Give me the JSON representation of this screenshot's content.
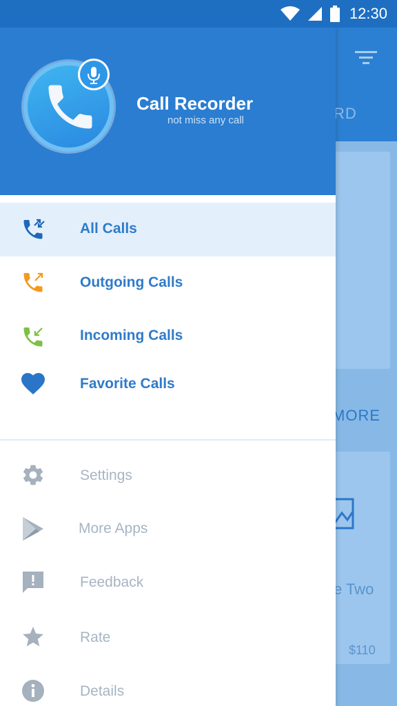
{
  "status_bar": {
    "time": "12:30"
  },
  "background_app": {
    "tab_fragment": "RD",
    "section_fragment": "MORE",
    "card_title_fragment": "e Two",
    "card_price": "$110"
  },
  "drawer": {
    "app_name": "Call Recorder",
    "tagline": "not miss any call",
    "primary_items": [
      {
        "label": "All Calls",
        "icon": "all-calls-icon",
        "active": true
      },
      {
        "label": "Outgoing Calls",
        "icon": "outgoing-call-icon"
      },
      {
        "label": "Incoming Calls",
        "icon": "incoming-call-icon"
      },
      {
        "label": "Favorite Calls",
        "icon": "heart-icon"
      }
    ],
    "secondary_items": [
      {
        "label": "Settings",
        "icon": "gear-icon"
      },
      {
        "label": "More Apps",
        "icon": "play-store-icon"
      },
      {
        "label": "Feedback",
        "icon": "feedback-icon"
      },
      {
        "label": "Rate",
        "icon": "star-icon"
      },
      {
        "label": "Details",
        "icon": "info-icon"
      }
    ]
  },
  "colors": {
    "header_blue": "#2a7dd1",
    "status_bar_blue": "#1e6fc2",
    "primary_text": "#2f7bc9",
    "secondary_text": "#a7b4c3",
    "active_bg": "#e3f0fc",
    "outgoing_orange": "#f39a1e",
    "incoming_green": "#7cc144"
  }
}
